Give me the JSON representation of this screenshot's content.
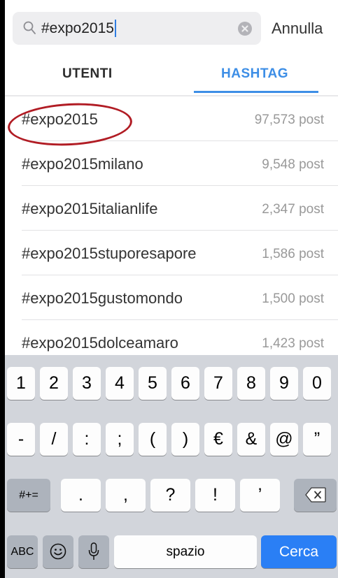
{
  "search": {
    "query": "#expo2015",
    "cancel_label": "Annulla"
  },
  "tabs": [
    {
      "label": "UTENTI",
      "active": false
    },
    {
      "label": "HASHTAG",
      "active": true
    }
  ],
  "colors": {
    "accent": "#3d8ee6",
    "highlight_circle": "#b11c24",
    "return_key": "#2a7ff5"
  },
  "results": [
    {
      "tag": "#expo2015",
      "count": "97,573 post",
      "highlighted": true
    },
    {
      "tag": "#expo2015milano",
      "count": "9,548 post"
    },
    {
      "tag": "#expo2015italianlife",
      "count": "2,347 post"
    },
    {
      "tag": "#expo2015stuporesapore",
      "count": "1,586 post"
    },
    {
      "tag": "#expo2015gustomondo",
      "count": "1,500 post"
    },
    {
      "tag": "#expo2015dolceamaro",
      "count": "1,423 post"
    }
  ],
  "keyboard": {
    "row1": [
      "1",
      "2",
      "3",
      "4",
      "5",
      "6",
      "7",
      "8",
      "9",
      "0"
    ],
    "row2": [
      "-",
      "/",
      ":",
      ";",
      "(",
      ")",
      "€",
      "&",
      "@",
      "”"
    ],
    "row3": {
      "mode": "#+=",
      "keys": [
        ".",
        ",",
        "?",
        "!",
        "’"
      ],
      "delete_icon": "backspace-icon"
    },
    "row4": {
      "abc": "ABC",
      "emoji_icon": "emoji-icon",
      "mic_icon": "microphone-icon",
      "space": "spazio",
      "return": "Cerca"
    }
  }
}
